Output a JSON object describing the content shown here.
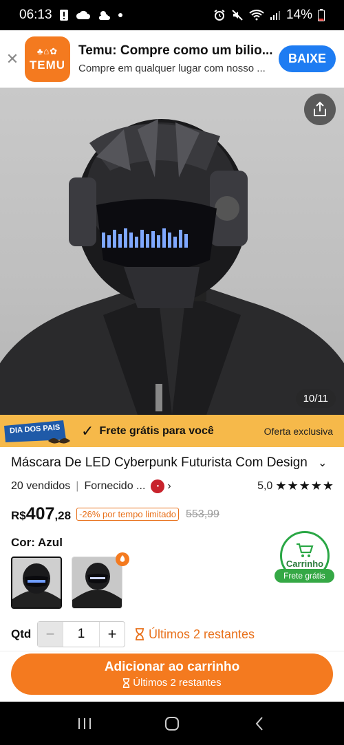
{
  "status_bar": {
    "time": "06:13",
    "battery": "14%"
  },
  "banner": {
    "logo_text": "TEMU",
    "title": "Temu: Compre como um bilio...",
    "subtitle": "Compre em qualquer lugar com nosso ...",
    "button": "BAIXE"
  },
  "gallery": {
    "counter": "10/11"
  },
  "promo": {
    "badge": "DIA DOS PAIS",
    "text": "Frete grátis para você",
    "right": "Oferta exclusiva"
  },
  "product": {
    "title": "Máscara De LED Cyberpunk Futurista Com Design",
    "sold": "20 vendidos",
    "supplier": "Fornecido ...",
    "rating": "5,0",
    "stars": "★★★★★",
    "currency": "R$",
    "price_int": "407",
    "price_dec": ",28",
    "discount": "-26% por tempo limitado",
    "old_price": "553,99",
    "color_label": "Cor: Azul"
  },
  "cart": {
    "label": "Carrinho",
    "free": "Frete grátis"
  },
  "quantity": {
    "label": "Qtd",
    "value": "1",
    "minus": "−",
    "plus": "+",
    "stock": "Últimos 2 restantes"
  },
  "add_button": {
    "label": "Adicionar ao carrinho",
    "sub": "Últimos 2 restantes"
  },
  "colors": {
    "accent": "#f47a1f",
    "promo": "#f6b94a",
    "green": "#2aa745",
    "banner_button": "#1e7cf2"
  }
}
